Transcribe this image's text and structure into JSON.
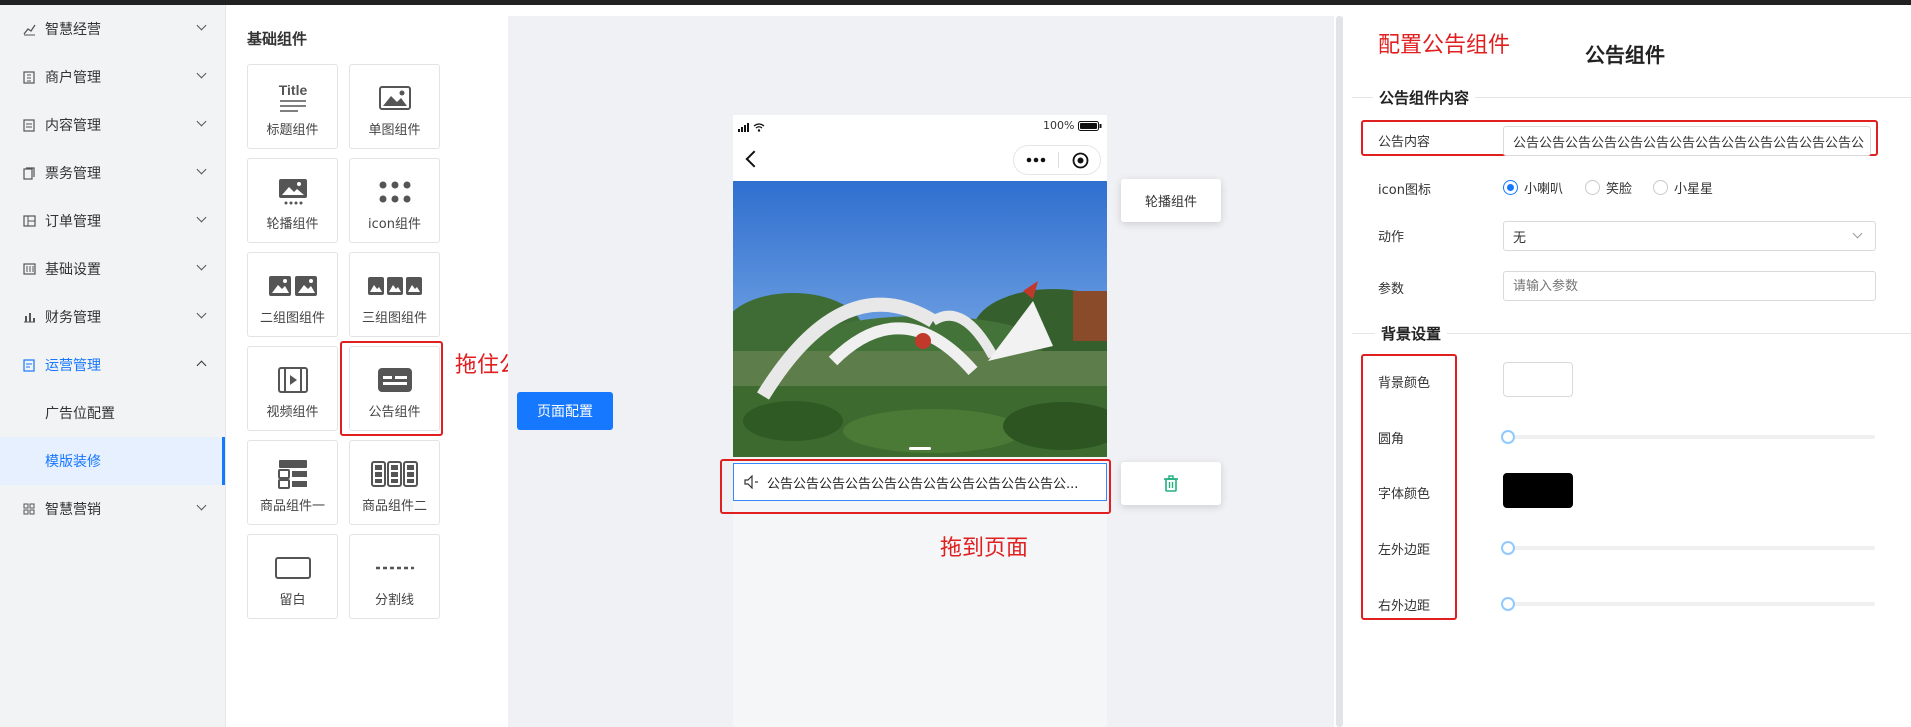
{
  "sidebar": {
    "items": [
      {
        "label": "智慧经营",
        "icon": "chart-line-icon"
      },
      {
        "label": "商户管理",
        "icon": "building-icon"
      },
      {
        "label": "内容管理",
        "icon": "document-icon"
      },
      {
        "label": "票务管理",
        "icon": "ticket-icon"
      },
      {
        "label": "订单管理",
        "icon": "order-icon"
      },
      {
        "label": "基础设置",
        "icon": "settings-grid-icon"
      },
      {
        "label": "财务管理",
        "icon": "bar-chart-icon"
      },
      {
        "label": "运营管理",
        "icon": "operation-icon"
      },
      {
        "label": "智慧营销",
        "icon": "marketing-grid-icon"
      }
    ],
    "sub_items": [
      "广告位配置",
      "模版装修"
    ]
  },
  "palette": {
    "title": "基础组件",
    "tiles": [
      {
        "label": "标题组件",
        "icon_text": "Title"
      },
      {
        "label": "单图组件"
      },
      {
        "label": "轮播组件"
      },
      {
        "label": "icon组件"
      },
      {
        "label": "二组图组件"
      },
      {
        "label": "三组图组件"
      },
      {
        "label": "视频组件"
      },
      {
        "label": "公告组件"
      },
      {
        "label": "商品组件一"
      },
      {
        "label": "商品组件二"
      },
      {
        "label": "留白"
      },
      {
        "label": "分割线"
      }
    ]
  },
  "annotations": {
    "drag_hold": "拖住公告组件",
    "drag_to_page": "拖到页面",
    "configure": "配置公告组件"
  },
  "canvas": {
    "page_config_button": "页面配置",
    "status_battery": "100%",
    "carousel_card_label": "轮播组件",
    "notice_text": "公告公告公告公告公告公告公告公告公告公告公告公..."
  },
  "right_panel": {
    "title": "公告组件",
    "section_content": "公告组件内容",
    "notice_label": "公告内容",
    "notice_value": "公告公告公告公告公告公告公告公告公告公告公告公告公告公",
    "icon_label": "icon图标",
    "icon_options": [
      "小喇叭",
      "笑脸",
      "小星星"
    ],
    "action_label": "动作",
    "action_value": "无",
    "param_label": "参数",
    "param_placeholder": "请输入参数",
    "section_bg": "背景设置",
    "bg_color_label": "背景颜色",
    "radius_label": "圆角",
    "font_color_label": "字体颜色",
    "left_margin_label": "左外边距",
    "right_margin_label": "右外边距",
    "bg_color": "#ffffff",
    "font_color": "#000000",
    "radius_value": 0,
    "left_margin_value": 0,
    "right_margin_value": 0
  },
  "colors": {
    "accent": "#1677ff",
    "annotation_red": "#e02020"
  }
}
